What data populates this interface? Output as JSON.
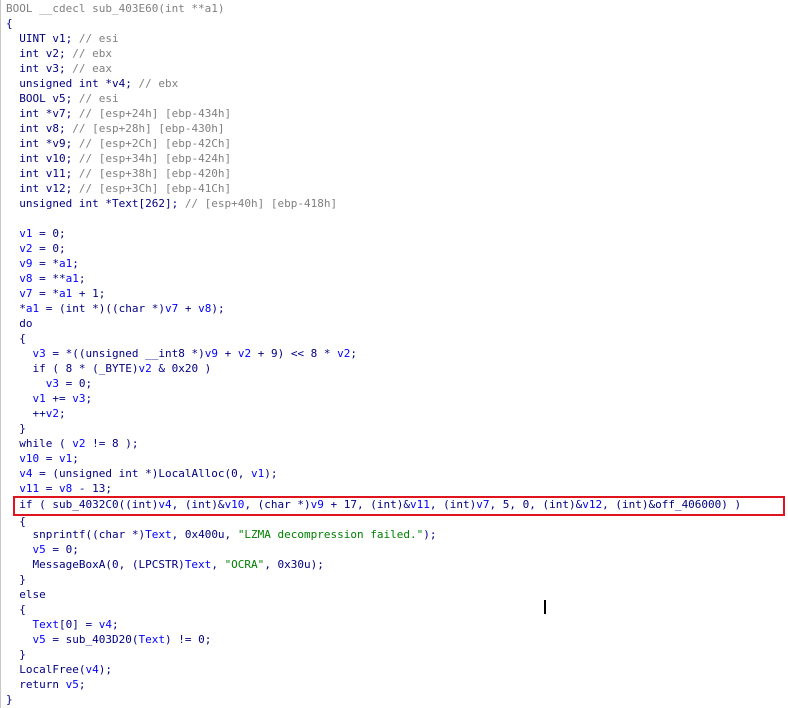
{
  "lines": [
    {
      "t": [
        [
          "gray",
          "BOOL __cdecl sub_403E60(int **a1)"
        ]
      ]
    },
    {
      "t": [
        [
          "plain",
          "{"
        ]
      ]
    },
    {
      "t": [
        [
          "plain",
          "  UINT v1; "
        ],
        [
          "cmt",
          "// esi"
        ]
      ]
    },
    {
      "t": [
        [
          "plain",
          "  int v2; "
        ],
        [
          "cmt",
          "// ebx"
        ]
      ]
    },
    {
      "t": [
        [
          "plain",
          "  int v3; "
        ],
        [
          "cmt",
          "// eax"
        ]
      ]
    },
    {
      "t": [
        [
          "plain",
          "  unsigned int *v4; "
        ],
        [
          "cmt",
          "// ebx"
        ]
      ]
    },
    {
      "t": [
        [
          "plain",
          "  BOOL v5; "
        ],
        [
          "cmt",
          "// esi"
        ]
      ]
    },
    {
      "t": [
        [
          "plain",
          "  int *v7; "
        ],
        [
          "cmt",
          "// [esp+24h] [ebp-434h]"
        ]
      ]
    },
    {
      "t": [
        [
          "plain",
          "  int v8; "
        ],
        [
          "cmt",
          "// [esp+28h] [ebp-430h]"
        ]
      ]
    },
    {
      "t": [
        [
          "plain",
          "  int *v9; "
        ],
        [
          "cmt",
          "// [esp+2Ch] [ebp-42Ch]"
        ]
      ]
    },
    {
      "t": [
        [
          "plain",
          "  int v10; "
        ],
        [
          "cmt",
          "// [esp+34h] [ebp-424h]"
        ]
      ]
    },
    {
      "t": [
        [
          "plain",
          "  int v11; "
        ],
        [
          "cmt",
          "// [esp+38h] [ebp-420h]"
        ]
      ]
    },
    {
      "t": [
        [
          "plain",
          "  int v12; "
        ],
        [
          "cmt",
          "// [esp+3Ch] [ebp-41Ch]"
        ]
      ]
    },
    {
      "t": [
        [
          "plain",
          "  unsigned int *Text[262]; "
        ],
        [
          "cmt",
          "// [esp+40h] [ebp-418h]"
        ]
      ]
    },
    {
      "t": [
        [
          "plain",
          ""
        ]
      ]
    },
    {
      "t": [
        [
          "var",
          "  v1"
        ],
        [
          "plain",
          " = 0;"
        ]
      ]
    },
    {
      "t": [
        [
          "var",
          "  v2"
        ],
        [
          "plain",
          " = 0;"
        ]
      ]
    },
    {
      "t": [
        [
          "var",
          "  v9"
        ],
        [
          "plain",
          " = *"
        ],
        [
          "var",
          "a1"
        ],
        [
          "plain",
          ";"
        ]
      ]
    },
    {
      "t": [
        [
          "var",
          "  v8"
        ],
        [
          "plain",
          " = **"
        ],
        [
          "var",
          "a1"
        ],
        [
          "plain",
          ";"
        ]
      ]
    },
    {
      "t": [
        [
          "var",
          "  v7"
        ],
        [
          "plain",
          " = *"
        ],
        [
          "var",
          "a1"
        ],
        [
          "plain",
          " + 1;"
        ]
      ]
    },
    {
      "t": [
        [
          "plain",
          "  *"
        ],
        [
          "var",
          "a1"
        ],
        [
          "plain",
          " = (int *)((char *)"
        ],
        [
          "var",
          "v7"
        ],
        [
          "plain",
          " + "
        ],
        [
          "var",
          "v8"
        ],
        [
          "plain",
          ");"
        ]
      ]
    },
    {
      "t": [
        [
          "plain",
          "  do"
        ]
      ]
    },
    {
      "t": [
        [
          "plain",
          "  {"
        ]
      ]
    },
    {
      "t": [
        [
          "var",
          "    v3"
        ],
        [
          "plain",
          " = *((unsigned __int8 *)"
        ],
        [
          "var",
          "v9"
        ],
        [
          "plain",
          " + "
        ],
        [
          "var",
          "v2"
        ],
        [
          "plain",
          " + 9) << 8 * "
        ],
        [
          "var",
          "v2"
        ],
        [
          "plain",
          ";"
        ]
      ]
    },
    {
      "t": [
        [
          "plain",
          "    if ( 8 * (_BYTE)"
        ],
        [
          "var",
          "v2"
        ],
        [
          "plain",
          " & 0x20 )"
        ]
      ]
    },
    {
      "t": [
        [
          "var",
          "      v3"
        ],
        [
          "plain",
          " = 0;"
        ]
      ]
    },
    {
      "t": [
        [
          "var",
          "    v1"
        ],
        [
          "plain",
          " += "
        ],
        [
          "var",
          "v3"
        ],
        [
          "plain",
          ";"
        ]
      ]
    },
    {
      "t": [
        [
          "plain",
          "    ++"
        ],
        [
          "var",
          "v2"
        ],
        [
          "plain",
          ";"
        ]
      ]
    },
    {
      "t": [
        [
          "plain",
          "  }"
        ]
      ]
    },
    {
      "t": [
        [
          "plain",
          "  while ( "
        ],
        [
          "var",
          "v2"
        ],
        [
          "plain",
          " != 8 );"
        ]
      ]
    },
    {
      "t": [
        [
          "var",
          "  v10"
        ],
        [
          "plain",
          " = "
        ],
        [
          "var",
          "v1"
        ],
        [
          "plain",
          ";"
        ]
      ]
    },
    {
      "t": [
        [
          "var",
          "  v4"
        ],
        [
          "plain",
          " = (unsigned int *)LocalAlloc(0, "
        ],
        [
          "var",
          "v1"
        ],
        [
          "plain",
          ");"
        ]
      ]
    },
    {
      "t": [
        [
          "var",
          "  v11"
        ],
        [
          "plain",
          " = "
        ],
        [
          "var",
          "v8"
        ],
        [
          "plain",
          " - 13;"
        ]
      ]
    },
    {
      "t": [
        [
          "plain",
          "  if ( sub_4032C0((int)"
        ],
        [
          "var",
          "v4"
        ],
        [
          "plain",
          ", (int)&"
        ],
        [
          "var",
          "v10"
        ],
        [
          "plain",
          ", (char *)"
        ],
        [
          "var",
          "v9"
        ],
        [
          "plain",
          " + 17, (int)&"
        ],
        [
          "var",
          "v11"
        ],
        [
          "plain",
          ", (int)"
        ],
        [
          "var",
          "v7"
        ],
        [
          "plain",
          ", 5, 0, (int)&"
        ],
        [
          "var",
          "v12"
        ],
        [
          "plain",
          ", (int)&off_406000) )"
        ]
      ]
    },
    {
      "t": [
        [
          "plain",
          "  {"
        ]
      ]
    },
    {
      "t": [
        [
          "plain",
          "    snprintf((char *)"
        ],
        [
          "var",
          "Text"
        ],
        [
          "plain",
          ", 0x400u, "
        ],
        [
          "str",
          "\"LZMA decompression failed.\""
        ],
        [
          "plain",
          ");"
        ]
      ]
    },
    {
      "t": [
        [
          "var",
          "    v5"
        ],
        [
          "plain",
          " = 0;"
        ]
      ]
    },
    {
      "t": [
        [
          "plain",
          "    MessageBoxA(0, (LPCSTR)"
        ],
        [
          "var",
          "Text"
        ],
        [
          "plain",
          ", "
        ],
        [
          "str",
          "\"OCRA\""
        ],
        [
          "plain",
          ", 0x30u);"
        ]
      ]
    },
    {
      "t": [
        [
          "plain",
          "  }"
        ]
      ]
    },
    {
      "t": [
        [
          "plain",
          "  else"
        ]
      ]
    },
    {
      "t": [
        [
          "plain",
          "  {"
        ]
      ]
    },
    {
      "t": [
        [
          "var",
          "    Text"
        ],
        [
          "plain",
          "[0] = "
        ],
        [
          "var",
          "v4"
        ],
        [
          "plain",
          ";"
        ]
      ]
    },
    {
      "t": [
        [
          "var",
          "    v5"
        ],
        [
          "plain",
          " = sub_403D20("
        ],
        [
          "var",
          "Text"
        ],
        [
          "plain",
          ") != 0;"
        ]
      ]
    },
    {
      "t": [
        [
          "plain",
          "  }"
        ]
      ]
    },
    {
      "t": [
        [
          "plain",
          "  LocalFree("
        ],
        [
          "var",
          "v4"
        ],
        [
          "plain",
          ");"
        ]
      ]
    },
    {
      "t": [
        [
          "plain",
          "  return "
        ],
        [
          "var",
          "v5"
        ],
        [
          "plain",
          ";"
        ]
      ]
    },
    {
      "t": [
        [
          "plain",
          "}"
        ]
      ]
    }
  ]
}
